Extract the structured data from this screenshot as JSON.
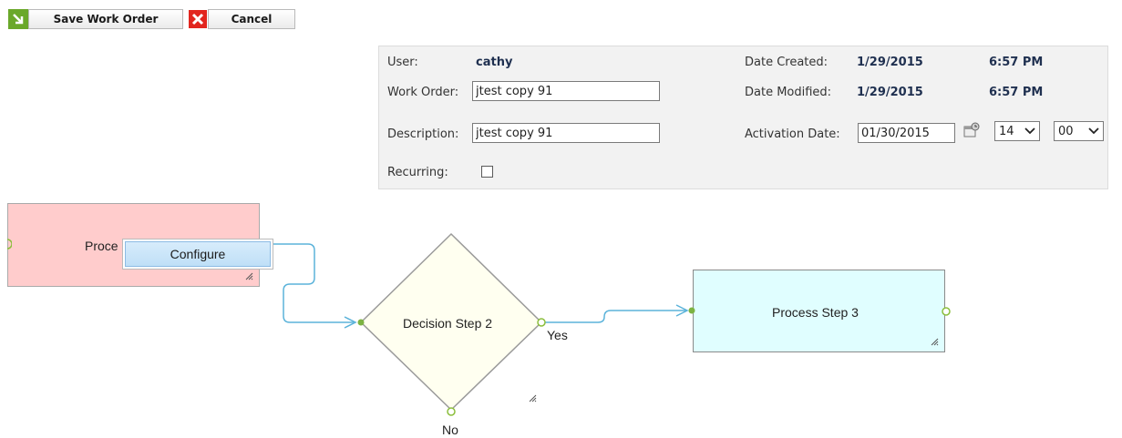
{
  "toolbar": {
    "save_label": "Save Work Order",
    "cancel_label": "Cancel",
    "save_icon": "arrow-icon",
    "cancel_icon": "close-icon"
  },
  "info": {
    "user_label": "User:",
    "user_value": "cathy",
    "work_order_label": "Work Order:",
    "work_order_value": "jtest copy 91",
    "description_label": "Description:",
    "description_value": "jtest copy 91",
    "recurring_label": "Recurring:",
    "recurring_checked": false,
    "date_created_label": "Date Created:",
    "date_created_value": "1/29/2015",
    "time_created_value": "6:57 PM",
    "date_modified_label": "Date Modified:",
    "date_modified_value": "1/29/2015",
    "time_modified_value": "6:57 PM",
    "activation_date_label": "Activation Date:",
    "activation_date_value": "01/30/2015",
    "activation_hour": "14",
    "activation_minute": "00",
    "calendar_icon": "calendar-icon"
  },
  "diagram": {
    "step1_label": "Proce",
    "context_menu_item": "Configure",
    "step2_label": "Decision Step 2",
    "yes_label": "Yes",
    "no_label": "No",
    "step3_label": "Process Step 3",
    "connector_color": "#5bb3da",
    "step1_color": "#ffcccc",
    "step2_color": "#fffff0",
    "step3_color": "#e0feff"
  }
}
